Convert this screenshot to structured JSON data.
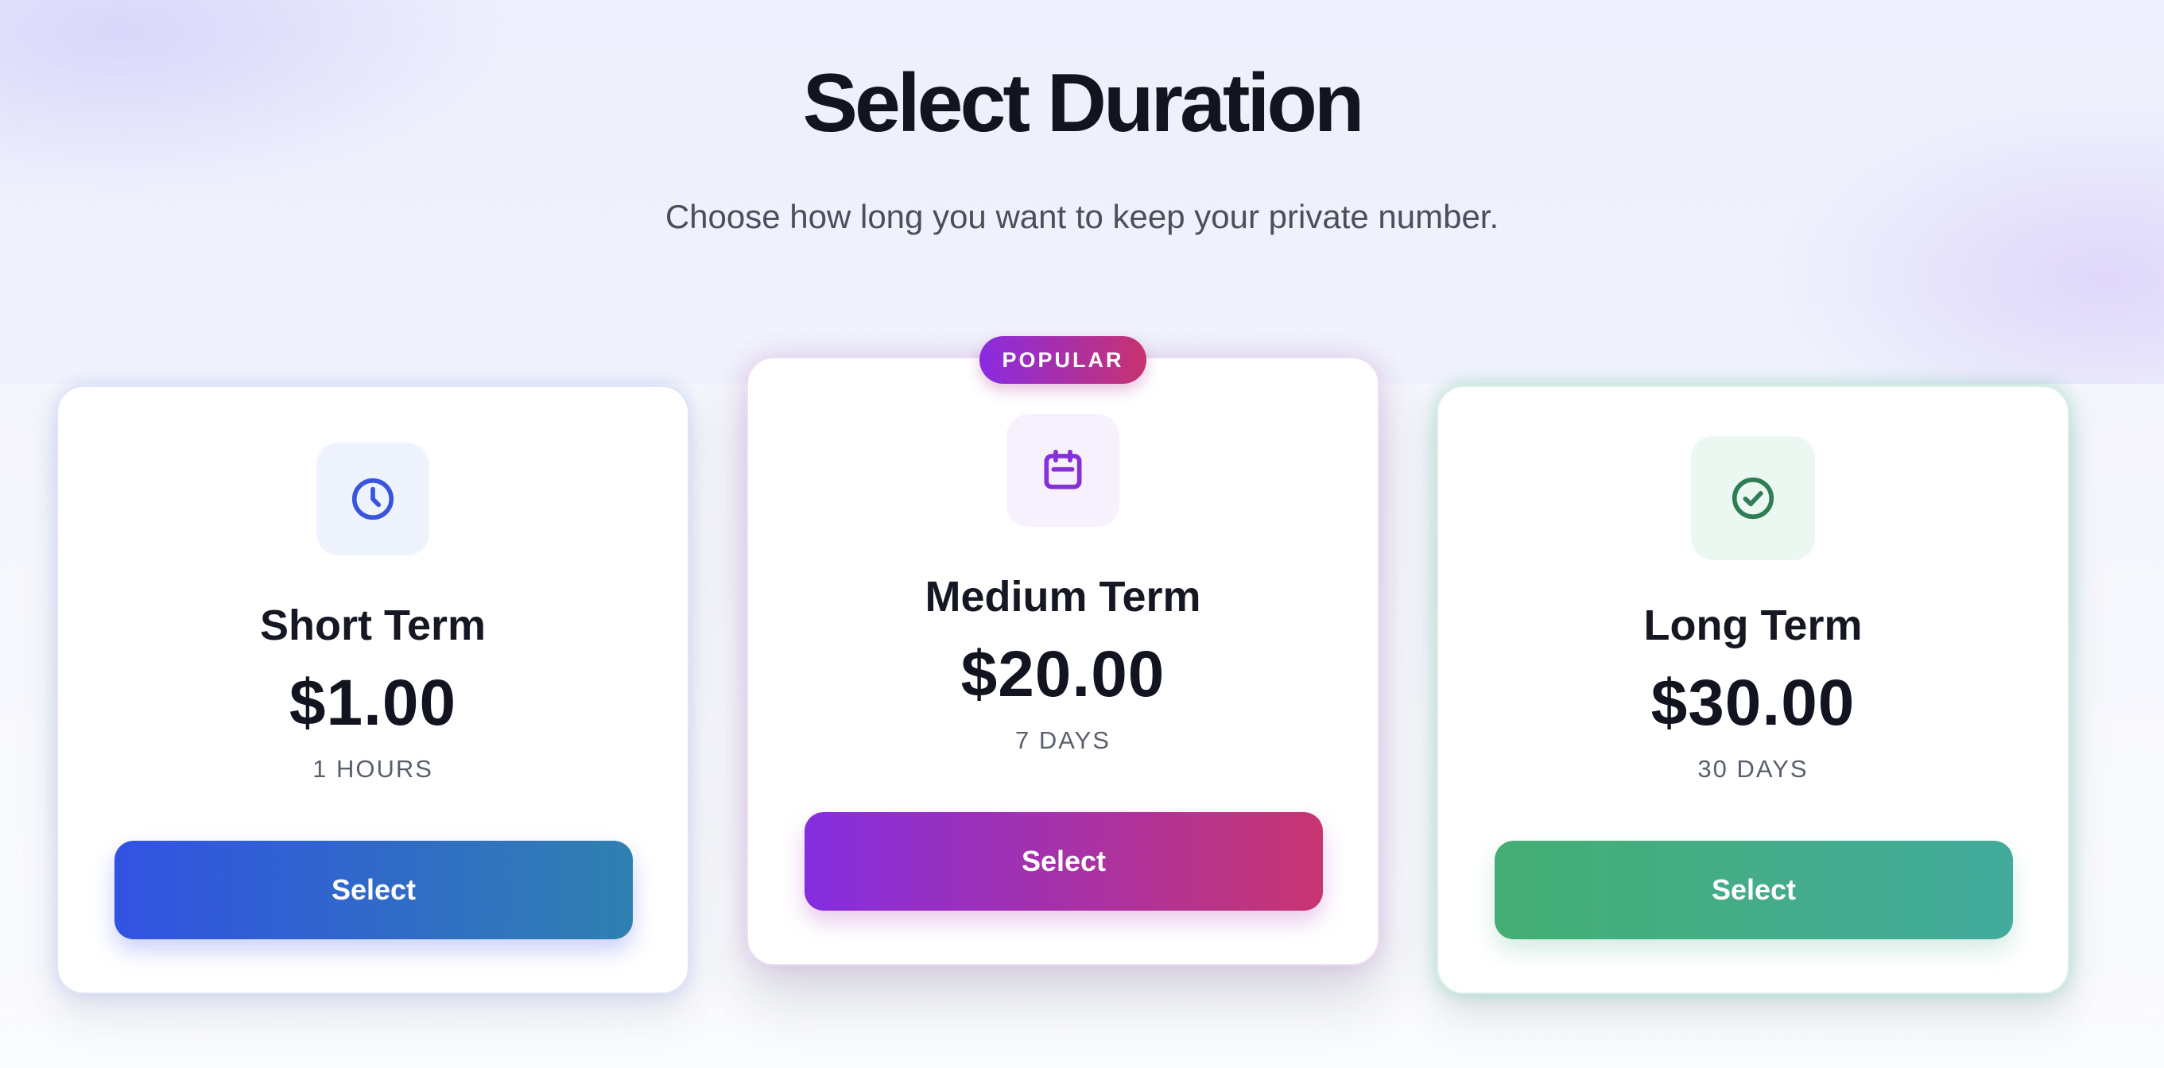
{
  "header": {
    "title": "Select Duration",
    "subtitle": "Choose how long you want to keep your private number."
  },
  "plans": [
    {
      "id": "short",
      "title": "Short Term",
      "price": "$1.00",
      "duration": "1 HOURS",
      "button_label": "Select",
      "icon": "clock-icon",
      "accent_color": "#3252e2"
    },
    {
      "id": "medium",
      "title": "Medium Term",
      "price": "$20.00",
      "duration": "7 DAYS",
      "button_label": "Select",
      "icon": "calendar-icon",
      "badge": "POPULAR",
      "accent_color": "#8a2be2"
    },
    {
      "id": "long",
      "title": "Long Term",
      "price": "$30.00",
      "duration": "30 DAYS",
      "button_label": "Select",
      "icon": "check-circle-icon",
      "accent_color": "#2e7d55"
    }
  ]
}
